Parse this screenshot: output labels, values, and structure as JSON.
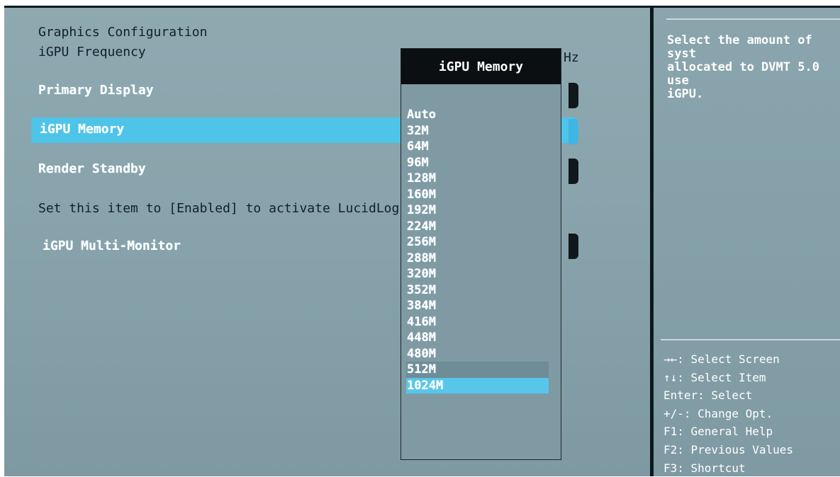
{
  "left": {
    "section_title": "Graphics Configuration",
    "frequency_label": "iGPU Frequency",
    "frequency_value_fragment": "Hz",
    "items": [
      {
        "label": "Primary Display"
      },
      {
        "label": "iGPU Memory"
      },
      {
        "label": "Render Standby"
      },
      {
        "label": "Set this item to [Enabled] to activate LucidLog"
      },
      {
        "label": "iGPU Multi-Monitor"
      }
    ]
  },
  "popup": {
    "title": "iGPU Memory",
    "options": [
      "Auto",
      "32M",
      "64M",
      "96M",
      "128M",
      "160M",
      "192M",
      "224M",
      "256M",
      "288M",
      "320M",
      "352M",
      "384M",
      "416M",
      "448M",
      "480M",
      "512M",
      "1024M"
    ],
    "selected": "1024M"
  },
  "help": {
    "lines": [
      "Select the amount of syst",
      "allocated to DVMT 5.0 use",
      "iGPU."
    ]
  },
  "keys": {
    "lines": [
      "→←: Select Screen",
      "↑↓: Select Item",
      "Enter: Select",
      "+/-: Change Opt.",
      "F1: General Help",
      "F2: Previous Values",
      "F3: Shortcut"
    ]
  },
  "colors": {
    "highlight": "#4ec4e8",
    "panel": "#88a3ab",
    "popup_header": "#0b0f11"
  }
}
